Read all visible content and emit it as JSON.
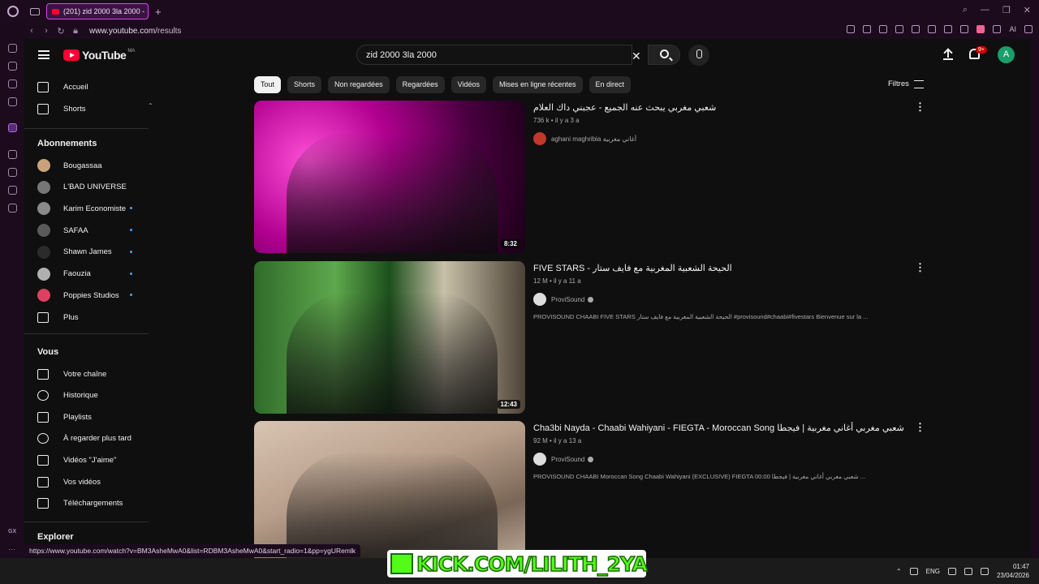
{
  "browser": {
    "tab_title": "(201) zid 2000 3la 2000 -",
    "url_host": "www.youtube.com",
    "url_path": "/results",
    "ext_label": "AI",
    "status_url": "https://www.youtube.com/watch?v=BM3AsheMwA0&list=RDBM3AsheMwA0&start_radio=1&pp=ygURemlk",
    "gx_label": "GX"
  },
  "header": {
    "logo_text": "YouTube",
    "region": "MA",
    "search_value": "zid 2000 3la 2000",
    "notif_count": "9+",
    "avatar_letter": "A"
  },
  "guide": {
    "main": [
      {
        "label": "Accueil",
        "icon": "home-icon"
      },
      {
        "label": "Shorts",
        "icon": "shorts-icon"
      }
    ],
    "subs_title": "Abonnements",
    "subs": [
      {
        "label": "Bougassaa",
        "color": "#c9a27c",
        "dot": false
      },
      {
        "label": "L'BAD UNIVERSE",
        "color": "#777777",
        "dot": false
      },
      {
        "label": "Karim Economiste",
        "color": "#8a8a8a",
        "dot": true
      },
      {
        "label": "SAFAA",
        "color": "#5a5a5a",
        "dot": true
      },
      {
        "label": "Shawn James",
        "color": "#2b2b2b",
        "dot": true
      },
      {
        "label": "Faouzia",
        "color": "#b0b0b0",
        "dot": true
      },
      {
        "label": "Poppies Studios",
        "color": "#e04060",
        "dot": true
      }
    ],
    "more_label": "Plus",
    "you_title": "Vous",
    "you": [
      {
        "label": "Votre chaîne",
        "icon": "channel-icon"
      },
      {
        "label": "Historique",
        "icon": "history-icon"
      },
      {
        "label": "Playlists",
        "icon": "playlists-icon"
      },
      {
        "label": "À regarder plus tard",
        "icon": "watch-later-icon"
      },
      {
        "label": "Vidéos \"J'aime\"",
        "icon": "like-icon"
      },
      {
        "label": "Vos vidéos",
        "icon": "your-videos-icon"
      },
      {
        "label": "Téléchargements",
        "icon": "downloads-icon"
      }
    ],
    "explore_title": "Explorer"
  },
  "chips": [
    "Tout",
    "Shorts",
    "Non regardées",
    "Regardées",
    "Vidéos",
    "Mises en ligne récentes",
    "En direct"
  ],
  "filters_label": "Filtres",
  "results": [
    {
      "title": "شعبي مغربي يبحث عنه الجميع - عجبني داك العلام",
      "meta": "736 k • il y a 3 a",
      "channel": "aghani maghribia أغاني مغربية",
      "verified": false,
      "description": "",
      "duration": "8:32",
      "channel_color": "#c0392b"
    },
    {
      "title": "FIVE STARS - الحيحة الشعبية المغربية مع فايف ستار",
      "meta": "12 M • il y a 11 a",
      "channel": "ProviSound",
      "verified": true,
      "description": "PROVISOUND CHAABI FIVE STARS الحيحة الشعبية المغربية مع فايف ستار #provisound#chaabi#fivestars Bienvenue sur la ...",
      "duration": "12:43",
      "channel_color": "#dddddd"
    },
    {
      "title": "Cha3bi Nayda - Chaabi Wahiyani - FIEGTA - Moroccan Song شعبي مغربي أغاني مغربية | فيجطا",
      "meta": "92 M • il y a 13 a",
      "channel": "ProviSound",
      "verified": true,
      "description": "PROVISOUND CHAABI Moroccan Song Chaabi Wahiyani (EXCLUSIVE) FIEGTA 00:00 شعبي مغربي أغاني مغربية | فيجطا ...",
      "duration": "",
      "channel_color": "#dddddd"
    }
  ],
  "taskbar": {
    "lang": "ENG",
    "time": "01:47",
    "date": "23/04/2026"
  },
  "overlay": {
    "text": "KICK.COM/LILITH_2YA"
  }
}
